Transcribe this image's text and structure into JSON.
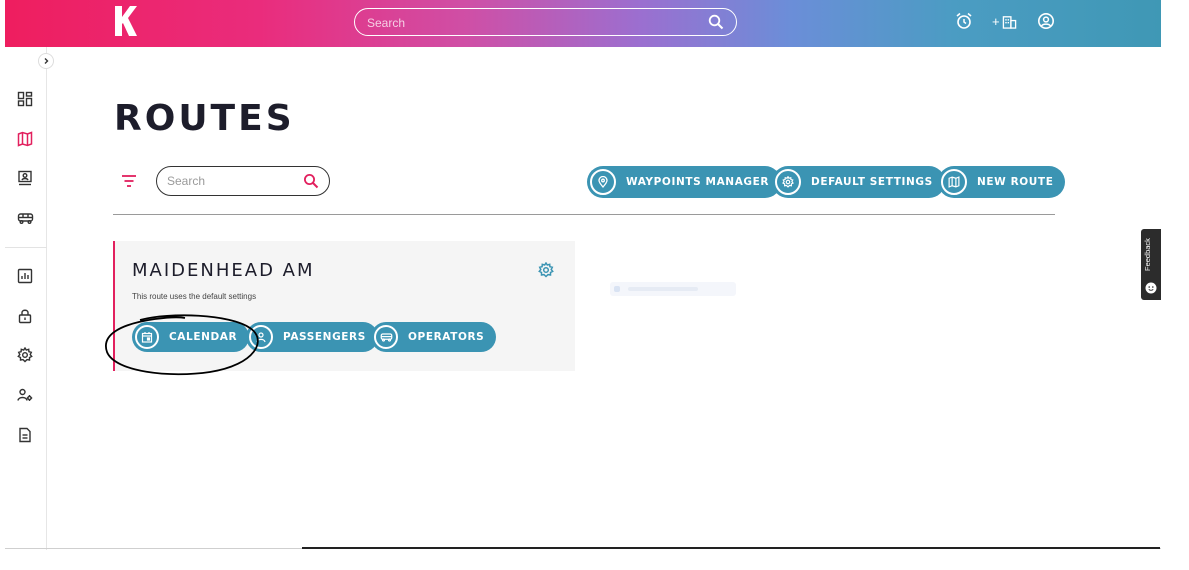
{
  "topbar": {
    "search_placeholder": "Search",
    "icons": [
      "logo-k",
      "search-icon",
      "alarm-clock-icon",
      "add-building-icon",
      "user-account-icon"
    ],
    "add_label": "+"
  },
  "sidebar": {
    "items": [
      {
        "name": "dashboard-icon"
      },
      {
        "name": "routes-map-icon",
        "active": true
      },
      {
        "name": "stops-board-icon"
      },
      {
        "name": "bus-icon"
      },
      {
        "name": "reports-chart-icon"
      },
      {
        "name": "lock-icon"
      },
      {
        "name": "settings-gear-icon"
      },
      {
        "name": "users-settings-icon"
      },
      {
        "name": "document-icon"
      }
    ]
  },
  "main": {
    "title": "ROUTES",
    "search_placeholder": "Search",
    "actions": {
      "waypoints": "WAYPOINTS MANAGER",
      "defaults": "DEFAULT SETTINGS",
      "new_route": "NEW ROUTE"
    },
    "route_card": {
      "title": "MAIDENHEAD AM",
      "subtitle": "This route uses the default settings",
      "buttons": {
        "calendar": "CALENDAR",
        "passengers": "PASSENGERS",
        "operators": "OPERATORS"
      }
    }
  },
  "feedback": {
    "label": "Feedback"
  },
  "colors": {
    "accent_pink": "#e2205e",
    "button_teal": "#3b94b3",
    "title_dark": "#1d1d2b"
  }
}
